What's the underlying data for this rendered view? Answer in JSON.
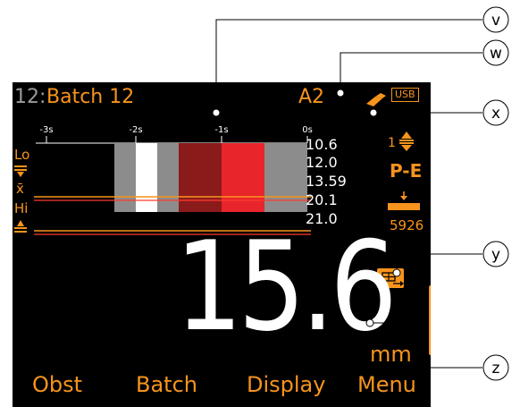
{
  "colors": {
    "accent": "#f7941d",
    "screen_bg": "#000000",
    "value": "#ffffff",
    "band_gray": "#8c8c8c",
    "band_white": "#ffffff",
    "band_darkred": "#8b1a1a",
    "band_red": "#e8252b",
    "hi_line": "#ff3b30"
  },
  "header": {
    "batch_number": "12:",
    "batch_name": "Batch 12",
    "probe_code": "A2",
    "usb_label": "USB",
    "usb_icon": "usb-connector-icon"
  },
  "timeline": {
    "ticks": [
      "-3s",
      "-2s",
      "-1s",
      "0s"
    ]
  },
  "limits": {
    "lo_label": "Lo",
    "mean_symbol": "x̄",
    "hi_label": "Hi",
    "values": [
      "10.6",
      "12.0",
      "13.59",
      "20.1",
      "21.0"
    ]
  },
  "side_panel": {
    "gain_value": "1",
    "mode": "P-E",
    "velocity": "5926",
    "gain_icon": "gain-adjust-icon",
    "probe_icon": "probe-contact-icon",
    "export_icon": "table-export-icon"
  },
  "reading": {
    "value": "15.6",
    "unit": "mm",
    "bar_fill": 0
  },
  "softkeys": [
    "Obst",
    "Batch",
    "Display",
    "Menu"
  ],
  "callouts": [
    "v",
    "w",
    "x",
    "y",
    "z"
  ]
}
